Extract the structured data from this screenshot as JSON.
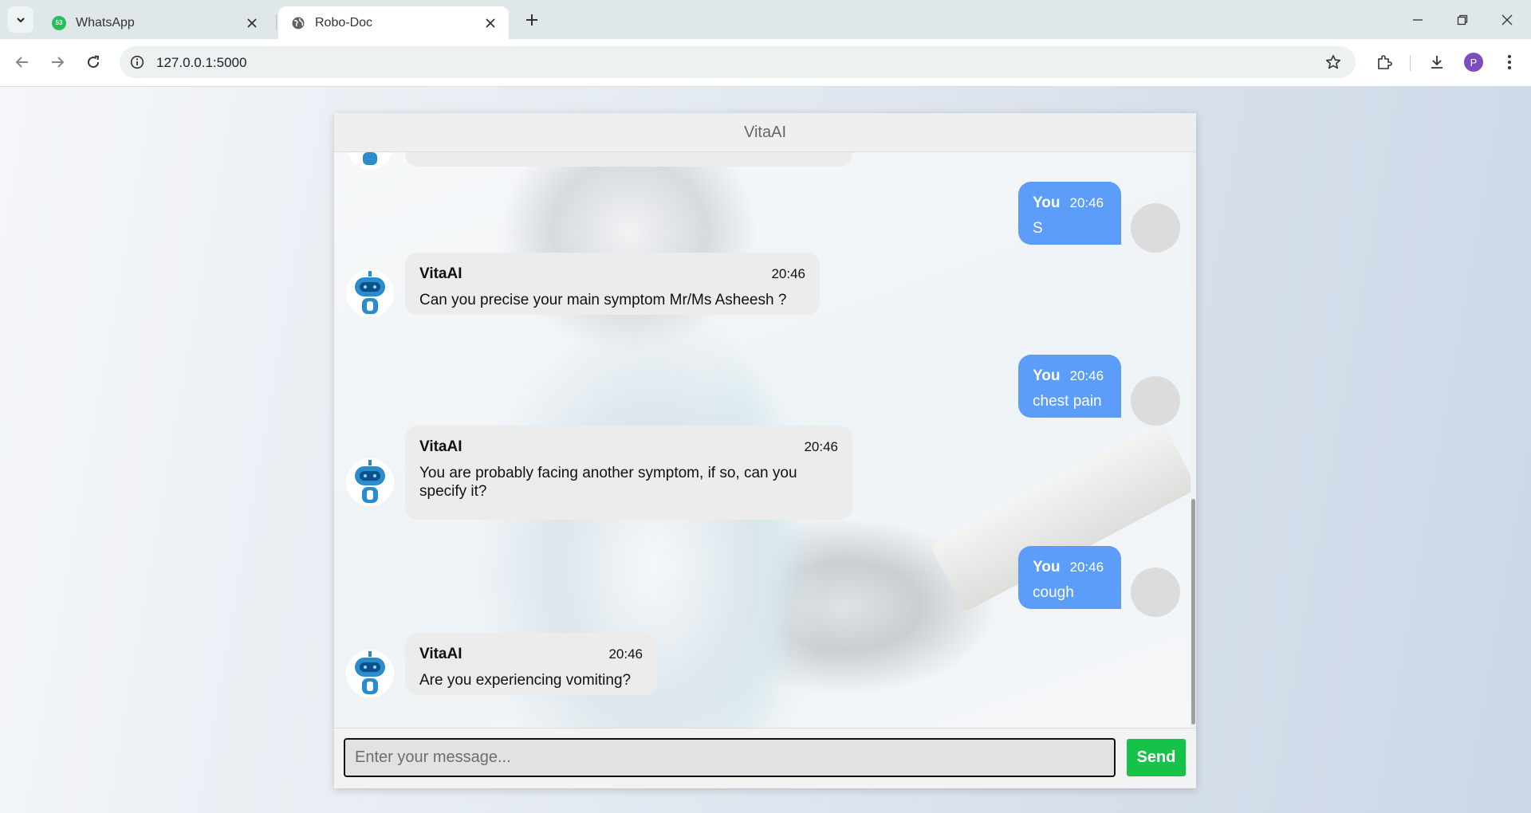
{
  "browser": {
    "tabs": [
      {
        "title": "WhatsApp",
        "badge": "53",
        "active": false
      },
      {
        "title": "Robo-Doc",
        "active": true
      }
    ],
    "url": "127.0.0.1:5000",
    "profile_initial": "P"
  },
  "chat": {
    "title": "VitaAI",
    "messages": [
      {
        "sender": "You",
        "time": "20:46",
        "text": "S"
      },
      {
        "sender": "VitaAI",
        "time": "20:46",
        "text": "Can you precise your main symptom Mr/Ms Asheesh ?"
      },
      {
        "sender": "You",
        "time": "20:46",
        "text": "chest pain"
      },
      {
        "sender": "VitaAI",
        "time": "20:46",
        "text": "You are probably facing another symptom, if so, can you specify it?"
      },
      {
        "sender": "You",
        "time": "20:46",
        "text": "cough"
      },
      {
        "sender": "VitaAI",
        "time": "20:46",
        "text": "Are you experiencing vomiting?"
      }
    ],
    "input_placeholder": "Enter your message...",
    "send_label": "Send"
  },
  "colors": {
    "user_bubble": "#5b9df9",
    "bot_bubble": "#ececec",
    "send_button": "#17c24b"
  }
}
